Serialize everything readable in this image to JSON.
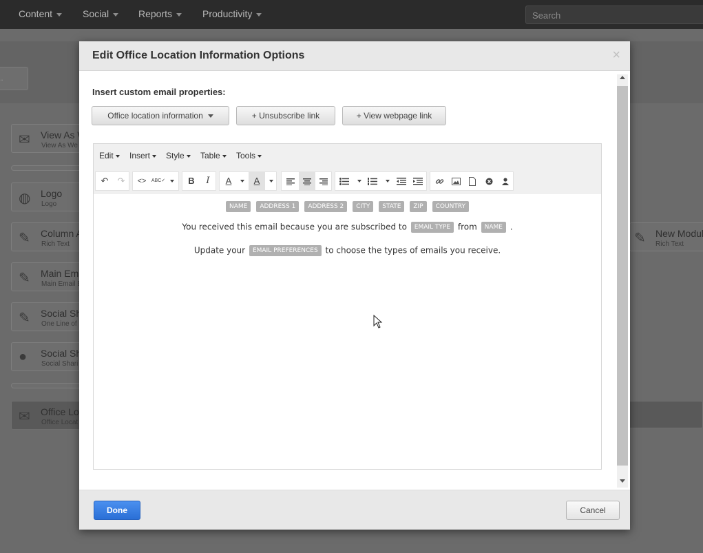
{
  "topnav": {
    "items": [
      {
        "label": "Content"
      },
      {
        "label": "Social"
      },
      {
        "label": "Reports"
      },
      {
        "label": "Productivity"
      }
    ],
    "search_placeholder": "Search"
  },
  "background": {
    "button_label": "..",
    "modules": [
      {
        "title": "View As W",
        "subtitle": "View As We",
        "icon": "envelope-icon"
      },
      {
        "title": "Logo",
        "subtitle": "Logo",
        "icon": "globe-icon"
      },
      {
        "title": "Column A",
        "subtitle": "Rich Text",
        "icon": "edit-icon"
      },
      {
        "title": "Main Ema",
        "subtitle": "Main Email B",
        "icon": "edit-icon"
      },
      {
        "title": "Social Sh",
        "subtitle": "One Line of",
        "icon": "edit-icon"
      },
      {
        "title": "Social Sh",
        "subtitle": "Social Shari",
        "icon": "comment-icon"
      },
      {
        "title": "Office Loc",
        "subtitle": "Office Locat",
        "icon": "envelope-icon"
      }
    ],
    "right_module": {
      "title": "New Module",
      "subtitle": "Rich Text",
      "icon": "edit-icon"
    }
  },
  "modal": {
    "title": "Edit Office Location Information Options",
    "close_symbol": "×",
    "insert_label": "Insert custom email properties:",
    "buttons": {
      "office_location": "Office location information",
      "unsubscribe": "+ Unsubscribe link",
      "view_webpage": "+ View webpage link"
    },
    "editor": {
      "menus": [
        "Edit",
        "Insert",
        "Style",
        "Table",
        "Tools"
      ],
      "tokens_row": [
        "NAME",
        "ADDRESS 1",
        "ADDRESS 2",
        "CITY",
        "STATE",
        "ZIP",
        "COUNTRY"
      ],
      "line1": {
        "before": "You received this email because you are subscribed to",
        "token1": "EMAIL TYPE",
        "middle": "from",
        "token2": "NAME",
        "after": "."
      },
      "line2": {
        "before": "Update your",
        "token": "EMAIL PREFERENCES",
        "after": "to choose the types of emails you receive."
      },
      "toolbar_icons": {
        "undo": "↶",
        "redo": "↷",
        "code": "<>",
        "spell": "ABC✓",
        "bold": "B",
        "italic": "I",
        "font_color": "A",
        "bg_color": "A",
        "link": "🔗",
        "image": "▣",
        "doc": "▯",
        "circle": "✪",
        "person": "▲"
      }
    },
    "footer": {
      "done": "Done",
      "cancel": "Cancel"
    }
  },
  "colors": {
    "accent_blue": "#2a6fd6",
    "token_gray": "#b0b0b0",
    "nav_bg": "#2b2b2b"
  }
}
